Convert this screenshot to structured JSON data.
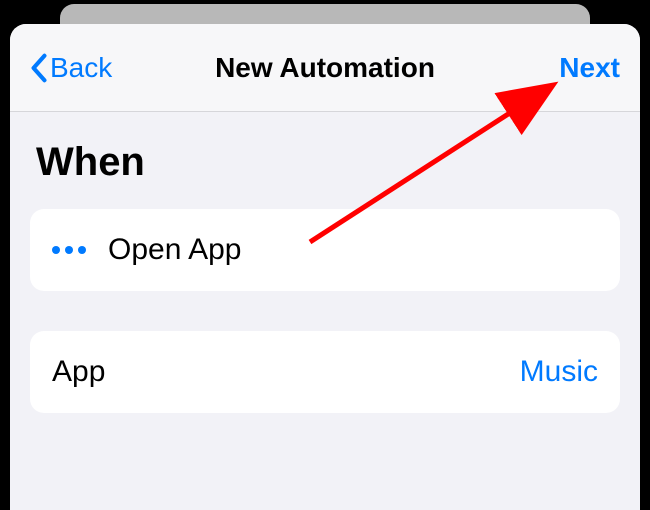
{
  "nav": {
    "back_label": "Back",
    "title": "New Automation",
    "next_label": "Next"
  },
  "section": {
    "title": "When"
  },
  "trigger_card": {
    "label": "Open App"
  },
  "app_card": {
    "label": "App",
    "value": "Music"
  }
}
